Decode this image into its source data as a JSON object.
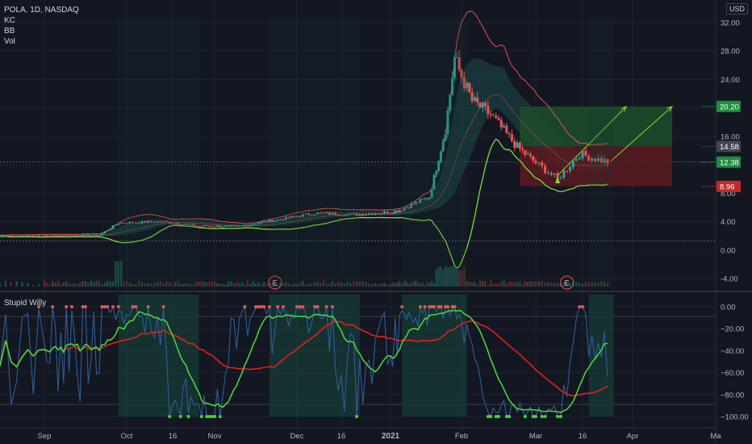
{
  "header": {
    "symbol_line": "POLA, 1D, NASDAQ",
    "indicators": [
      "KC",
      "BB",
      "Vol"
    ],
    "currency": "USD"
  },
  "oscillator": {
    "title": "Stupid Willy"
  },
  "colors": {
    "background": "#131722",
    "grid": "#1f2330",
    "up": "#26a69a",
    "down": "#ef5350",
    "kc_upper": "#e65050",
    "bb_lower": "#7ddc3a",
    "teal_band": "#1e4a4a",
    "osc_line": "#2f5d98",
    "osc_green": "#4cd23a",
    "osc_red": "#e0201c",
    "profit_zone": "#1d4d2a",
    "loss_zone": "#5c1a1f"
  },
  "chart_data": [
    {
      "type": "candlestick",
      "name": "price",
      "x_ticks": [
        "Sep",
        "Oct",
        "16",
        "Nov",
        "Dec",
        "16",
        "2021",
        "Feb",
        "Mar",
        "16",
        "Apr",
        "Ma"
      ],
      "y_ticks": [
        "32.00",
        "28.00",
        "24.00",
        "20.00",
        "16.00",
        "12.00",
        "8.00",
        "4.00",
        "0.00",
        "-4.00"
      ],
      "ylim": [
        -5,
        34
      ],
      "price_labels": [
        {
          "value": "20.20",
          "kind": "target"
        },
        {
          "value": "14.58",
          "kind": "entry"
        },
        {
          "value": "12.38",
          "kind": "last"
        },
        {
          "value": "8.96",
          "kind": "stop"
        }
      ],
      "price_label_values": [
        20.2,
        14.58,
        12.38,
        8.96
      ],
      "earnings_markers": [
        {
          "label": "E",
          "date": "Nov 23"
        },
        {
          "label": "E",
          "date": "Mar 11"
        }
      ],
      "close_series_approx": [
        {
          "date": "Aug 24",
          "close": 2.0
        },
        {
          "date": "Sep 21",
          "close": 2.1
        },
        {
          "date": "Sep 28",
          "close": 3.8
        },
        {
          "date": "Oct 12",
          "close": 4.0
        },
        {
          "date": "Oct 26",
          "close": 3.4
        },
        {
          "date": "Nov 9",
          "close": 3.3
        },
        {
          "date": "Nov 23",
          "close": 4.2
        },
        {
          "date": "Dec 7",
          "close": 5.2
        },
        {
          "date": "Dec 21",
          "close": 5.0
        },
        {
          "date": "Jan 4",
          "close": 5.5
        },
        {
          "date": "Jan 18",
          "close": 7.5
        },
        {
          "date": "Jan 25",
          "close": 17.0
        },
        {
          "date": "Jan 29",
          "close": 27.0
        },
        {
          "date": "Feb 5",
          "close": 21.0
        },
        {
          "date": "Feb 12",
          "close": 19.0
        },
        {
          "date": "Feb 22",
          "close": 14.5
        },
        {
          "date": "Mar 8",
          "close": 10.0
        },
        {
          "date": "Mar 15",
          "close": 13.5
        },
        {
          "date": "Mar 24",
          "close": 12.38
        }
      ],
      "long_position": {
        "entry": 14.58,
        "target": 20.2,
        "stop": 8.96,
        "from": "Feb 23",
        "to": "Apr 8"
      }
    },
    {
      "type": "line",
      "name": "Stupid Willy",
      "y_ticks": [
        "0.00",
        "-20.00",
        "-40.00",
        "-60.00",
        "-80.00",
        "-100.00"
      ],
      "ylim": [
        -105,
        5
      ]
    }
  ]
}
